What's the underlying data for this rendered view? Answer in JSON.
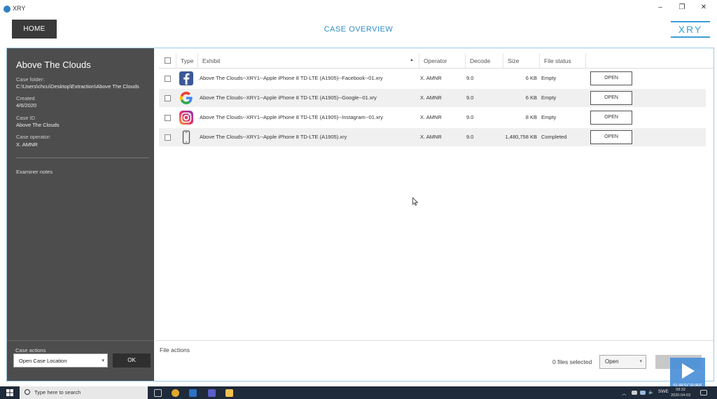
{
  "window": {
    "title": "XRY",
    "minimize": "–",
    "restore": "❐",
    "close": "✕"
  },
  "header": {
    "home_label": "HOME",
    "page_title": "CASE OVERVIEW",
    "logo_text": "XRY"
  },
  "sidebar": {
    "case_name": "Above The Clouds",
    "case_folder_label": "Case folder:",
    "case_folder_value": "C:\\Users\\chcu\\Desktop\\Extraction\\Above The Clouds",
    "created_label": "Created",
    "created_value": "4/6/2020",
    "case_id_label": "Case ID",
    "case_id_value": "Above The Clouds",
    "case_operator_label": "Case operator:",
    "case_operator_value": "X. AMNR",
    "examiner_notes_label": "Examiner notes",
    "case_actions_label": "Case actions",
    "case_action_selected": "Open Case Location",
    "ok_label": "OK"
  },
  "table": {
    "columns": {
      "type": "Type",
      "exhibit": "Exhibit",
      "operator": "Operator",
      "decode": "Decode",
      "size": "Size",
      "file_status": "File status"
    },
    "sort_indicator": "▲",
    "rows": [
      {
        "icon": "facebook-icon",
        "exhibit": "Above The Clouds--XRY1--Apple iPhone 8 TD-LTE (A1905)--Facebook--01.xry",
        "operator": "X. AMNR",
        "decode": "9.0",
        "size": "6 KB",
        "status": "Empty",
        "action": "OPEN"
      },
      {
        "icon": "google-icon",
        "exhibit": "Above The Clouds--XRY1--Apple iPhone 8 TD-LTE (A1905)--Google--01.xry",
        "operator": "X. AMNR",
        "decode": "9.0",
        "size": "6 KB",
        "status": "Empty",
        "action": "OPEN"
      },
      {
        "icon": "instagram-icon",
        "exhibit": "Above The Clouds--XRY1--Apple iPhone 8 TD-LTE (A1905)--Instagram--01.xry",
        "operator": "X. AMNR",
        "decode": "9.0",
        "size": "8 KB",
        "status": "Empty",
        "action": "OPEN"
      },
      {
        "icon": "phone-icon",
        "exhibit": "Above The Clouds--XRY1--Apple iPhone 8 TD-LTE (A1905).xry",
        "operator": "X. AMNR",
        "decode": "9.0",
        "size": "1,480,758 KB",
        "status": "Completed",
        "action": "OPEN"
      }
    ]
  },
  "file_actions": {
    "label": "File actions",
    "files_selected": "0 files selected",
    "action_selected": "Open"
  },
  "overlay": {
    "subscribe": "SUBSCRIBE"
  },
  "taskbar": {
    "search_placeholder": "Type here to search",
    "language": "SWE",
    "time": "08:32",
    "date": "2020-04-03"
  }
}
